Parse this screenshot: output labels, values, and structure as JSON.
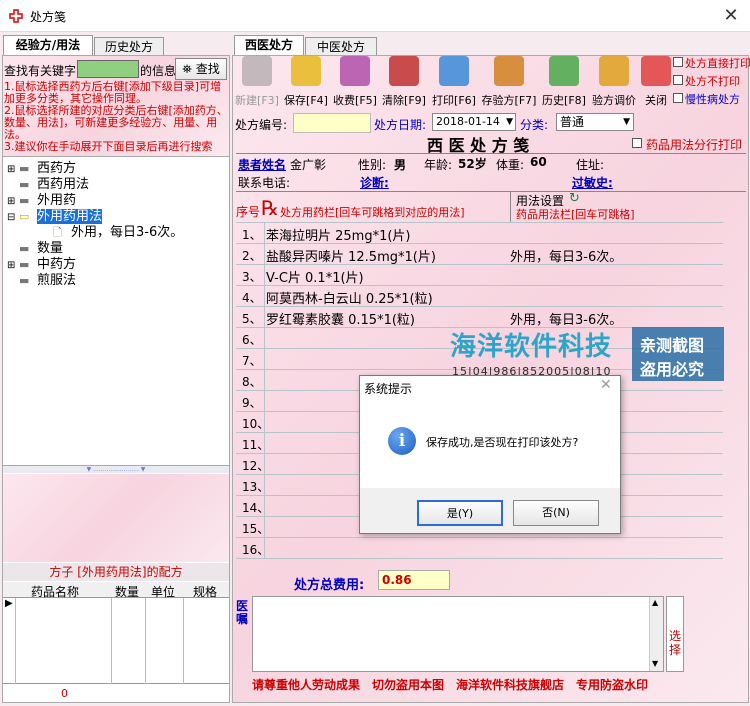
{
  "window": {
    "title": "处方笺",
    "close": "✕"
  },
  "left_tabs": [
    "经验方/用法",
    "历史处方"
  ],
  "right_tabs": [
    "西医处方",
    "中医处方"
  ],
  "search": {
    "prefix": "查找有关键字",
    "suffix": "的信息",
    "button": "查找",
    "value": ""
  },
  "tips": [
    "1.鼠标选择西药方后右键[添加下级目录]可增加更多分类，其它操作同理。",
    "2.鼠标选择所建的对应分类后右键[添加药方、数量、用法]，可新建更多经验方、用量、用法。",
    "3.建议你在手动展开下面目录后再进行搜索"
  ],
  "tree": [
    {
      "label": "西药方",
      "level": 0,
      "expander": "⊞"
    },
    {
      "label": "西药用法",
      "level": 0,
      "expander": ""
    },
    {
      "label": "外用药",
      "level": 0,
      "expander": "⊞"
    },
    {
      "label": "外用药用法",
      "level": 0,
      "expander": "⊟",
      "selected": true
    },
    {
      "label": "外用，每日3-6次。",
      "level": 1,
      "expander": ""
    },
    {
      "label": "数量",
      "level": 0,
      "expander": ""
    },
    {
      "label": "中药方",
      "level": 0,
      "expander": "⊞"
    },
    {
      "label": "煎服法",
      "level": 0,
      "expander": ""
    }
  ],
  "prescription_box": {
    "title": "方子 [外用药用法]的配方",
    "columns": [
      "药品名称",
      "数量",
      "单位",
      "规格"
    ],
    "total": "0"
  },
  "toolbar": [
    {
      "label": "新建[F3]",
      "disabled": true
    },
    {
      "label": "保存[F4]"
    },
    {
      "label": "收费[F5]"
    },
    {
      "label": "清除[F9]"
    },
    {
      "label": "打印[F6]"
    },
    {
      "label": "存验方[F7]"
    },
    {
      "label": "历史[F8]"
    },
    {
      "label": "验方调价"
    },
    {
      "label": "关闭"
    }
  ],
  "options": [
    "处方直接打印",
    "处方不打印",
    "慢性病处方"
  ],
  "form": {
    "rx_no_label": "处方编号:",
    "rx_no": "",
    "date_label": "处方日期:",
    "date": "2018-01-14",
    "category_label": "分类:",
    "category": "普通",
    "split_print": "药品用法分行打印",
    "heading": "西 医 处 方 笺"
  },
  "patient": {
    "name_label": "患者姓名",
    "name": "金广彰",
    "sex_label": "性别:",
    "sex": "男",
    "age_label": "年龄:",
    "age": "52岁",
    "weight_label": "体重:",
    "weight": "60",
    "addr_label": "住址:",
    "phone_label": "联系电话:",
    "diag_label": "诊断:",
    "allergy_label": "过敏史:"
  },
  "grid_header": {
    "no": "序号",
    "drug": "处方用药栏[回车可跳格到对应的用法]",
    "usage_top": "用法设置",
    "usage": "药品用法栏[回车可跳格]"
  },
  "rows": [
    {
      "n": "1、",
      "drug": "苯海拉明片 25mg*1(片)",
      "usage": ""
    },
    {
      "n": "2、",
      "drug": "盐酸异丙嗪片 12.5mg*1(片)",
      "usage": "外用，每日3-6次。"
    },
    {
      "n": "3、",
      "drug": "V-C片 0.1*1(片)",
      "usage": ""
    },
    {
      "n": "4、",
      "drug": "阿莫西林-白云山 0.25*1(粒)",
      "usage": ""
    },
    {
      "n": "5、",
      "drug": "罗红霉素胶囊 0.15*1(粒)",
      "usage": "外用，每日3-6次。"
    },
    {
      "n": "6、",
      "drug": "",
      "usage": ""
    },
    {
      "n": "7、",
      "drug": "",
      "usage": ""
    },
    {
      "n": "8、",
      "drug": "",
      "usage": ""
    },
    {
      "n": "9、",
      "drug": "",
      "usage": ""
    },
    {
      "n": "10、",
      "drug": "",
      "usage": ""
    },
    {
      "n": "11、",
      "drug": "",
      "usage": ""
    },
    {
      "n": "12、",
      "drug": "",
      "usage": ""
    },
    {
      "n": "13、",
      "drug": "",
      "usage": ""
    },
    {
      "n": "14、",
      "drug": "",
      "usage": ""
    },
    {
      "n": "15、",
      "drug": "",
      "usage": ""
    },
    {
      "n": "16、",
      "drug": "",
      "usage": ""
    }
  ],
  "total": {
    "label": "处方总费用:",
    "value": "0.86"
  },
  "advice": {
    "label": "医嘱",
    "select": "选择"
  },
  "footer": "请尊重他人劳动成果　切勿盗用本图　海洋软件科技旗舰店　专用防盗水印",
  "watermark": {
    "brand": "海洋软件科技",
    "tag1": "亲测截图",
    "tag2": "盗用必究",
    "digits": "15|04|986|852005|08|10"
  },
  "dialog": {
    "title": "系统提示",
    "message": "保存成功,是否现在打印该处方?",
    "yes": "是(Y)",
    "no": "否(N)",
    "icon": "i"
  }
}
